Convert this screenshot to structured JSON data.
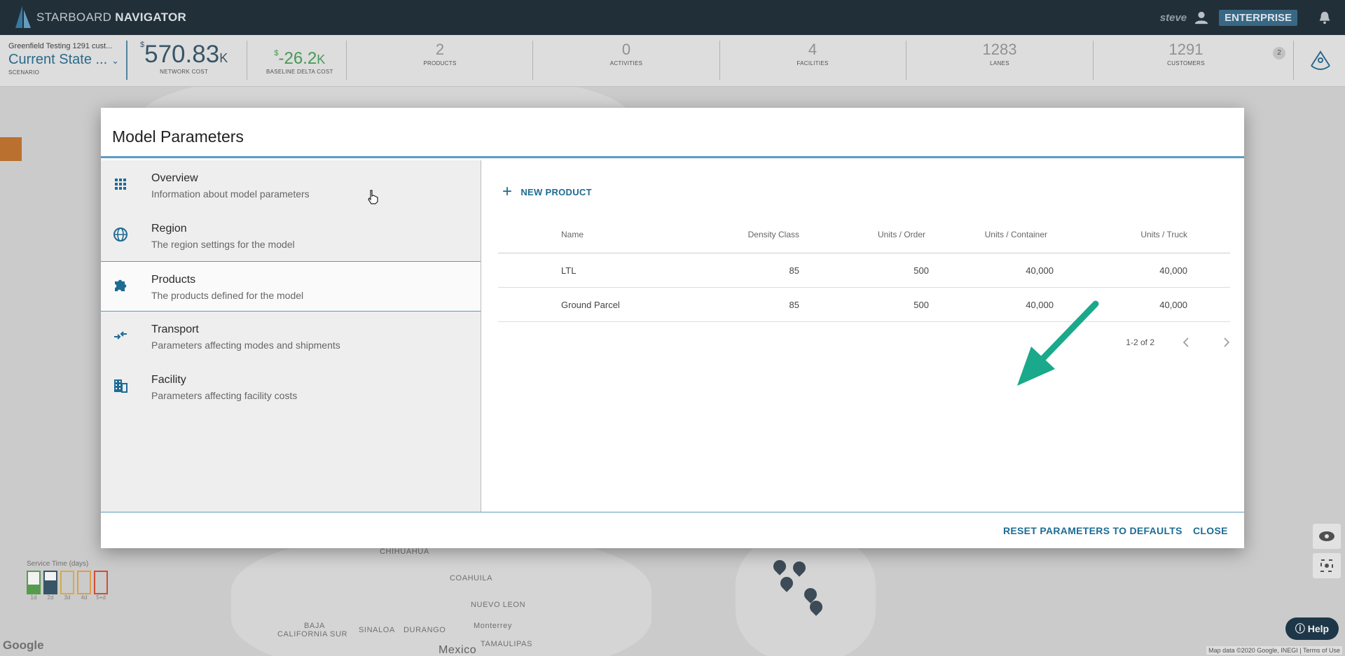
{
  "app": {
    "brand_light": "STARBOARD",
    "brand_bold": "NAVIGATOR",
    "user": "steve",
    "edition": "ENTERPRISE"
  },
  "stats": {
    "scenario_sub": "Greenfield Testing 1291 cust...",
    "scenario_title": "Current State ...",
    "scenario_label": "SCENARIO",
    "network_cost": {
      "currency": "$",
      "value": "570.83",
      "unit": "K",
      "label": "NETWORK COST"
    },
    "baseline_delta": {
      "currency": "$",
      "value": "-26.2",
      "unit": "K",
      "label": "BASELINE DELTA COST"
    },
    "items": [
      {
        "value": "2",
        "label": "PRODUCTS"
      },
      {
        "value": "0",
        "label": "ACTIVITIES"
      },
      {
        "value": "4",
        "label": "FACILITIES"
      },
      {
        "value": "1283",
        "label": "LANES"
      },
      {
        "value": "1291",
        "label": "CUSTOMERS"
      }
    ],
    "badge": "2"
  },
  "map": {
    "labels": [
      "CHIHUAHUA",
      "COAHUILA",
      "NUEVO LEON",
      "SINALOA",
      "DURANGO",
      "TAMAULIPAS",
      "BAJA",
      "CALIFORNIA SUR",
      "Monterrey",
      "Mexico"
    ],
    "service_time_title": "Service Time (days)",
    "service_time_labels": [
      "1d",
      "2d",
      "3d",
      "4d",
      "5+d"
    ],
    "google": "Google",
    "map_data": "Map data ©2020 Google, INEGI",
    "terms": "Terms of Use",
    "help": "Help"
  },
  "dialog": {
    "title": "Model Parameters",
    "nav": [
      {
        "title": "Overview",
        "desc": "Information about model parameters",
        "icon": "grid-icon"
      },
      {
        "title": "Region",
        "desc": "The region settings for the model",
        "icon": "globe-icon"
      },
      {
        "title": "Products",
        "desc": "The products defined for the model",
        "icon": "puzzle-icon"
      },
      {
        "title": "Transport",
        "desc": "Parameters affecting modes and shipments",
        "icon": "transport-icon"
      },
      {
        "title": "Facility",
        "desc": "Parameters affecting facility costs",
        "icon": "building-icon"
      }
    ],
    "new_product": "NEW PRODUCT",
    "columns": [
      "Name",
      "Density Class",
      "Units / Order",
      "Units / Container",
      "Units / Truck"
    ],
    "rows": [
      {
        "name": "LTL",
        "density": "85",
        "units_order": "500",
        "units_container": "40,000",
        "units_truck": "40,000"
      },
      {
        "name": "Ground Parcel",
        "density": "85",
        "units_order": "500",
        "units_container": "40,000",
        "units_truck": "40,000"
      }
    ],
    "pagination": "1-2 of 2",
    "reset_label": "RESET PARAMETERS TO DEFAULTS",
    "close_label": "CLOSE"
  },
  "colors": {
    "accent": "#1e6b94",
    "topbar": "#23323c",
    "annotation_arrow": "#1aa98a"
  }
}
